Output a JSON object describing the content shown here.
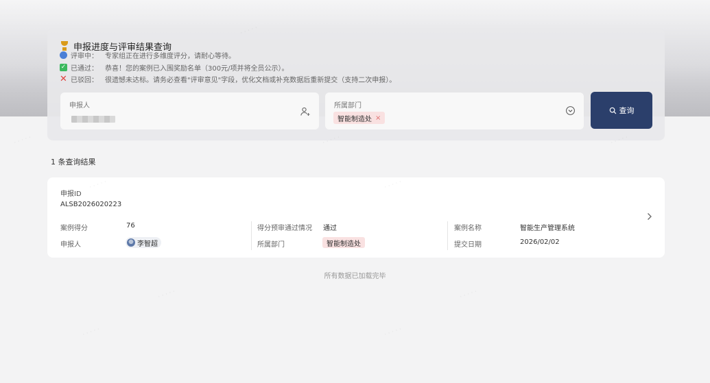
{
  "panel": {
    "title": "申报进度与评审结果查询",
    "status": [
      {
        "label": "评审中：",
        "text": "专家组正在进行多维度评分，请耐心等待。",
        "icon": "dot-icon",
        "color": "#4a7fd6"
      },
      {
        "label": "已通过：",
        "text": "恭喜！您的案例已入围奖励名单（300元/项并将全员公示）。",
        "icon": "check-icon",
        "color": "#3cb95e"
      },
      {
        "label": "已驳回：",
        "text": "很遗憾未达标。请务必查看\"评审意见\"字段，优化文档或补充数据后重新提交（支持二次申报）。",
        "icon": "x-icon",
        "color": "#e0413e"
      }
    ]
  },
  "search": {
    "reporter_label": "申报人",
    "dept_label": "所属部门",
    "dept_tag": "智能制造处",
    "tag_close": "×",
    "button_label": "查询"
  },
  "results": {
    "count_text": "1 条查询结果",
    "card": {
      "id_label": "申报ID",
      "id_value": "ALSB2026020223",
      "score_label": "案例得分",
      "score_value": "76",
      "reporter_label": "申报人",
      "reporter_value": "李智超",
      "pass_label": "得分预审通过情况",
      "pass_value": "通过",
      "dept_label": "所属部门",
      "dept_value": "智能制造处",
      "case_label": "案例名称",
      "case_value": "智能生产管理系统",
      "date_label": "提交日期",
      "date_value": "2026/02/02"
    }
  },
  "footer": {
    "note": "所有数据已加载完毕"
  },
  "colors": {
    "primary_button": "#2b3f6b",
    "tag_bg": "#f9e1e1"
  }
}
